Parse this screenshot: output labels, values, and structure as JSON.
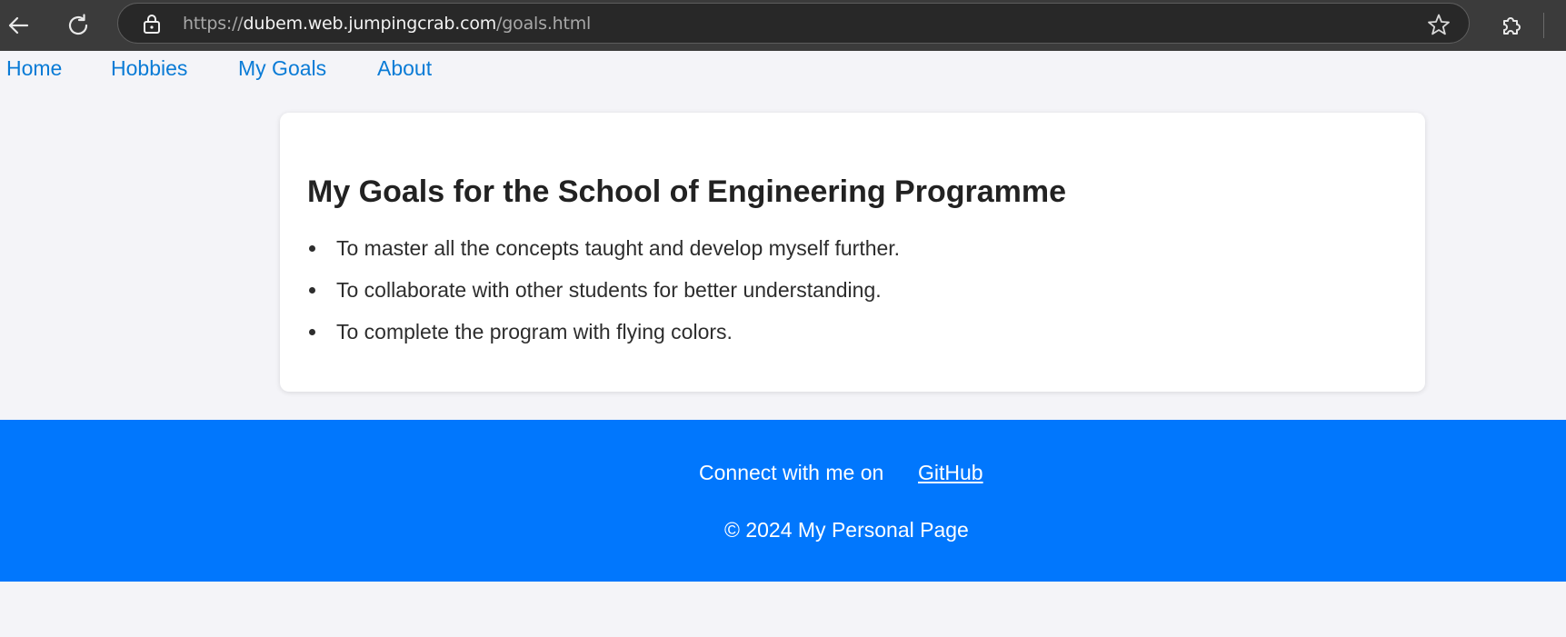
{
  "browser": {
    "url_scheme": "https://",
    "url_host": "dubem.web.jumpingcrab.com",
    "url_path": "/goals.html",
    "icons": [
      "back-arrow-icon",
      "reload-icon",
      "lock-icon",
      "star-icon",
      "extensions-icon"
    ]
  },
  "nav": {
    "items": [
      {
        "label": "Home"
      },
      {
        "label": "Hobbies"
      },
      {
        "label": "My Goals"
      },
      {
        "label": "About"
      }
    ]
  },
  "main": {
    "title": "My Goals for the School of Engineering Programme",
    "goals": [
      "To master all the concepts taught and develop myself further.",
      "To collaborate with other students for better understanding.",
      "To complete the program with flying colors."
    ]
  },
  "footer": {
    "connect_text": "Connect with me on",
    "github_label": "GitHub",
    "copyright": "© 2024 My Personal Page"
  },
  "colors": {
    "page_background": "#f4f4f8",
    "link": "#0a7bd6",
    "footer_background": "#0177fd",
    "browser_chrome": "#3b3b3b"
  }
}
